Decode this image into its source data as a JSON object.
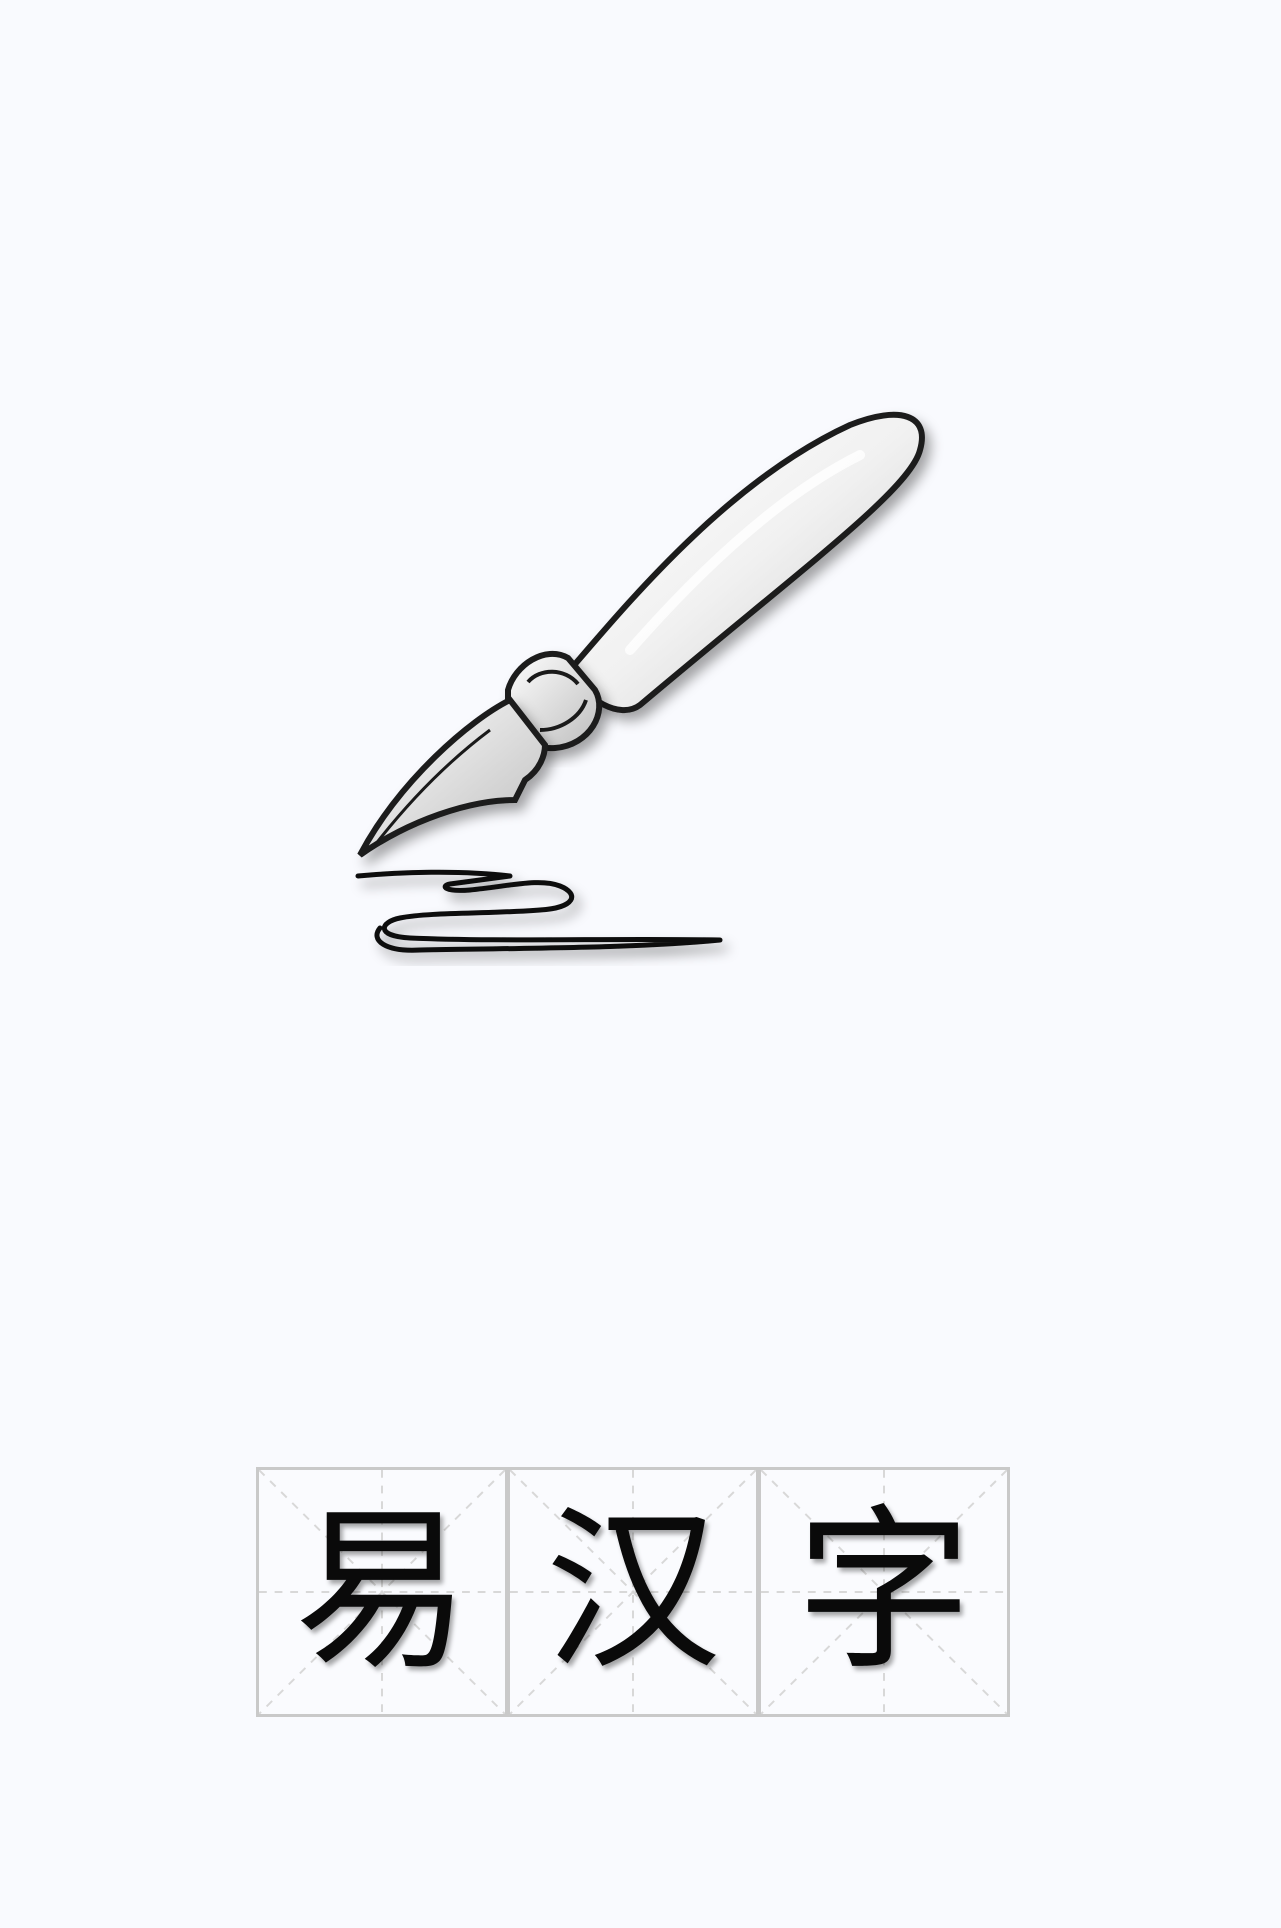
{
  "app": {
    "title_characters": [
      "易",
      "汉",
      "字"
    ]
  },
  "logo": {
    "icon": "fountain-pen-icon"
  },
  "colors": {
    "background": "#f9fafe",
    "grid_border": "#c9c9c9",
    "grid_guides": "#d8d8d8",
    "ink": "#0a0a0a"
  }
}
